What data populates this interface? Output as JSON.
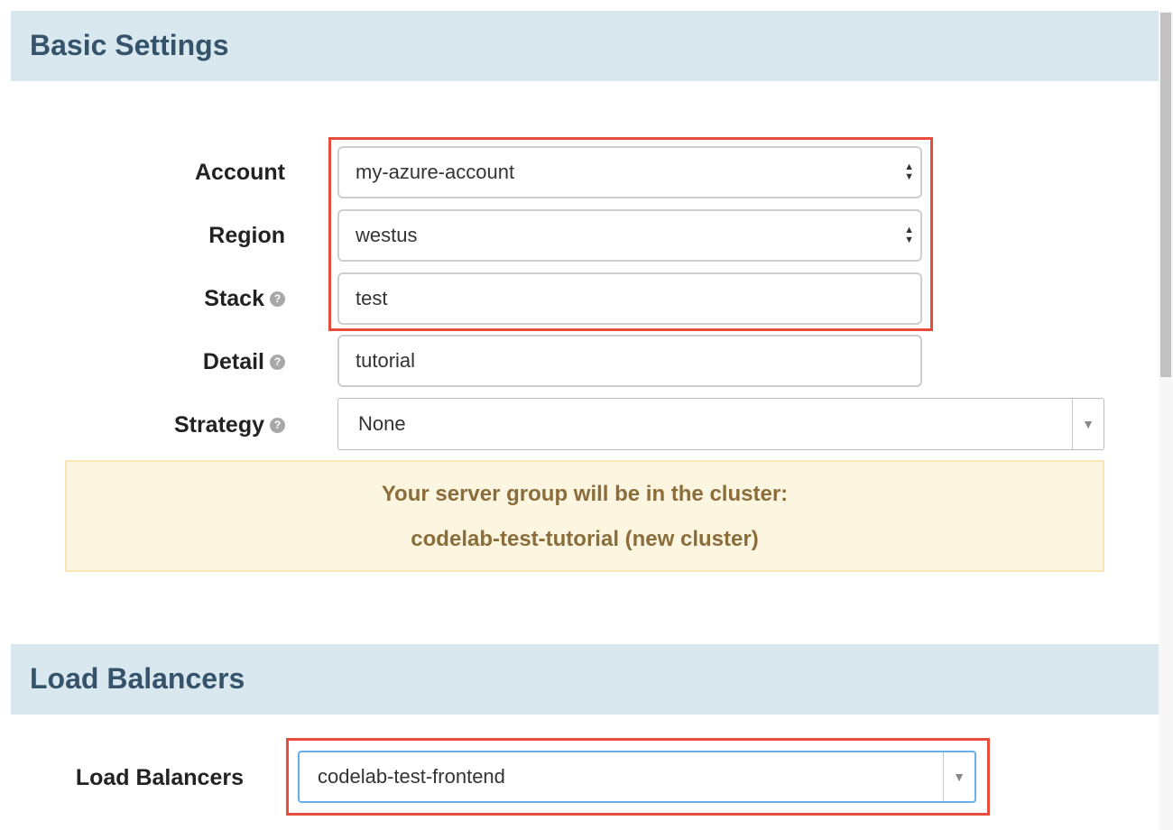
{
  "basic_settings": {
    "title": "Basic Settings",
    "fields": {
      "account": {
        "label": "Account",
        "value": "my-azure-account"
      },
      "region": {
        "label": "Region",
        "value": "westus"
      },
      "stack": {
        "label": "Stack",
        "value": "test",
        "help_icon": "?"
      },
      "detail": {
        "label": "Detail",
        "value": "tutorial",
        "help_icon": "?"
      },
      "strategy": {
        "label": "Strategy",
        "value": "None",
        "help_icon": "?"
      }
    },
    "notice": {
      "line1": "Your server group will be in the cluster:",
      "line2": "codelab-test-tutorial (new cluster)"
    }
  },
  "load_balancers": {
    "title": "Load Balancers",
    "label": "Load Balancers",
    "value": "codelab-test-frontend"
  },
  "colors": {
    "section_header_bg": "#d9e8ee",
    "section_title": "#35536b",
    "highlight": "#e74c3c",
    "notice_bg": "#fcf6e1",
    "notice_text": "#8a6d3b",
    "focus_border": "#66afe9"
  }
}
